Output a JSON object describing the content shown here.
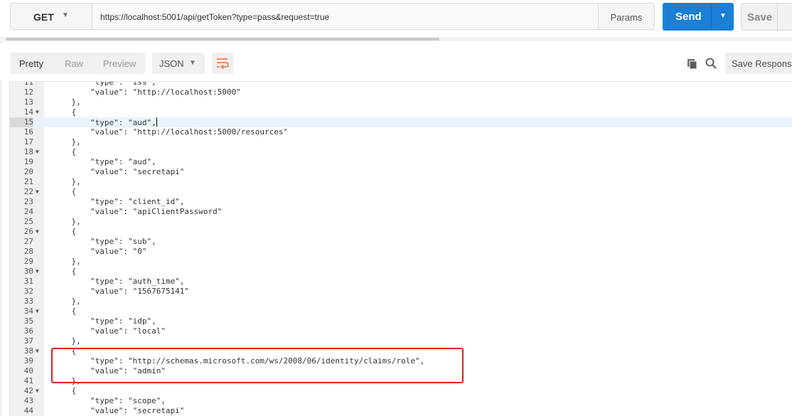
{
  "request": {
    "method": "GET",
    "url": "https://localhost:5001/api/getToken?type=pass&request=true",
    "params_label": "Params",
    "send_label": "Send",
    "save_label": "Save"
  },
  "response_toolbar": {
    "view_tabs": [
      "Pretty",
      "Raw",
      "Preview"
    ],
    "active_view": "Pretty",
    "format": "JSON",
    "save_response_label": "Save Response"
  },
  "editor": {
    "active_line": "15",
    "lines": [
      {
        "n": "11",
        "fold": false,
        "t": "        \"type\": \"iss\","
      },
      {
        "n": "12",
        "fold": false,
        "t": "        \"value\": \"http://localhost:5000\""
      },
      {
        "n": "13",
        "fold": false,
        "t": "    },"
      },
      {
        "n": "14",
        "fold": true,
        "t": "    {"
      },
      {
        "n": "15",
        "fold": false,
        "t": "        \"type\": \"aud\","
      },
      {
        "n": "16",
        "fold": false,
        "t": "        \"value\": \"http://localhost:5000/resources\""
      },
      {
        "n": "17",
        "fold": false,
        "t": "    },"
      },
      {
        "n": "18",
        "fold": true,
        "t": "    {"
      },
      {
        "n": "19",
        "fold": false,
        "t": "        \"type\": \"aud\","
      },
      {
        "n": "20",
        "fold": false,
        "t": "        \"value\": \"secretapi\""
      },
      {
        "n": "21",
        "fold": false,
        "t": "    },"
      },
      {
        "n": "22",
        "fold": true,
        "t": "    {"
      },
      {
        "n": "23",
        "fold": false,
        "t": "        \"type\": \"client_id\","
      },
      {
        "n": "24",
        "fold": false,
        "t": "        \"value\": \"apiClientPassword\""
      },
      {
        "n": "25",
        "fold": false,
        "t": "    },"
      },
      {
        "n": "26",
        "fold": true,
        "t": "    {"
      },
      {
        "n": "27",
        "fold": false,
        "t": "        \"type\": \"sub\","
      },
      {
        "n": "28",
        "fold": false,
        "t": "        \"value\": \"0\""
      },
      {
        "n": "29",
        "fold": false,
        "t": "    },"
      },
      {
        "n": "30",
        "fold": true,
        "t": "    {"
      },
      {
        "n": "31",
        "fold": false,
        "t": "        \"type\": \"auth_time\","
      },
      {
        "n": "32",
        "fold": false,
        "t": "        \"value\": \"1567675141\""
      },
      {
        "n": "33",
        "fold": false,
        "t": "    },"
      },
      {
        "n": "34",
        "fold": true,
        "t": "    {"
      },
      {
        "n": "35",
        "fold": false,
        "t": "        \"type\": \"idp\","
      },
      {
        "n": "36",
        "fold": false,
        "t": "        \"value\": \"local\""
      },
      {
        "n": "37",
        "fold": false,
        "t": "    },"
      },
      {
        "n": "38",
        "fold": true,
        "t": "    {"
      },
      {
        "n": "39",
        "fold": false,
        "t": "        \"type\": \"http://schemas.microsoft.com/ws/2008/06/identity/claims/role\","
      },
      {
        "n": "40",
        "fold": false,
        "t": "        \"value\": \"admin\""
      },
      {
        "n": "41",
        "fold": false,
        "t": "    },"
      },
      {
        "n": "42",
        "fold": true,
        "t": "    {"
      },
      {
        "n": "43",
        "fold": false,
        "t": "        \"type\": \"scope\","
      },
      {
        "n": "44",
        "fold": false,
        "t": "        \"value\": \"secretapi\""
      }
    ]
  },
  "colors": {
    "send_blue": "#1a7fd6",
    "annotation_red": "#e02020",
    "wrap_icon_orange": "#f26b3a",
    "active_line_bg": "#eaf3fd"
  }
}
